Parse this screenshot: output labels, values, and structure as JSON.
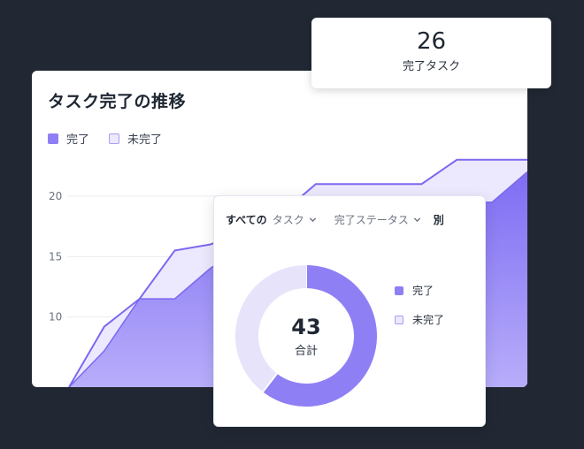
{
  "stat": {
    "value": "26",
    "label": "完了タスク"
  },
  "chart": {
    "title": "タスク完了の推移",
    "legend": {
      "completed": "完了",
      "incomplete": "未完了"
    }
  },
  "chart_data": {
    "type": "area",
    "title": "タスク完了の推移",
    "ytick_labels": [
      "20",
      "15",
      "10"
    ],
    "ylim": [
      4.2,
      23.5
    ],
    "grid": true,
    "series": [
      {
        "name": "完了",
        "color": "#8e7ff5",
        "values": [
          4.2,
          7.2,
          11.5,
          11.5,
          14.0,
          16.0,
          17.5,
          19.5,
          19.5,
          19.5,
          19.5,
          19.5,
          19.5,
          22.0
        ]
      },
      {
        "name": "未完了",
        "color": "#ece9ff",
        "values": [
          4.2,
          9.2,
          11.5,
          15.5,
          16.0,
          17.0,
          18.5,
          21.0,
          21.0,
          21.0,
          21.0,
          23.0,
          23.0,
          23.0
        ]
      }
    ]
  },
  "donut": {
    "filter_prefix": "すべての",
    "filter_task": "タスク",
    "filter_status": "完了ステータス",
    "filter_suffix": "別",
    "total": "43",
    "total_label": "合計",
    "legend": {
      "completed": "完了",
      "incomplete": "未完了"
    },
    "chart_data": {
      "type": "pie",
      "labels": [
        "完了",
        "未完了"
      ],
      "values": [
        26,
        17
      ],
      "colors": [
        "#8e7ff5",
        "#e6e3fb"
      ]
    }
  }
}
